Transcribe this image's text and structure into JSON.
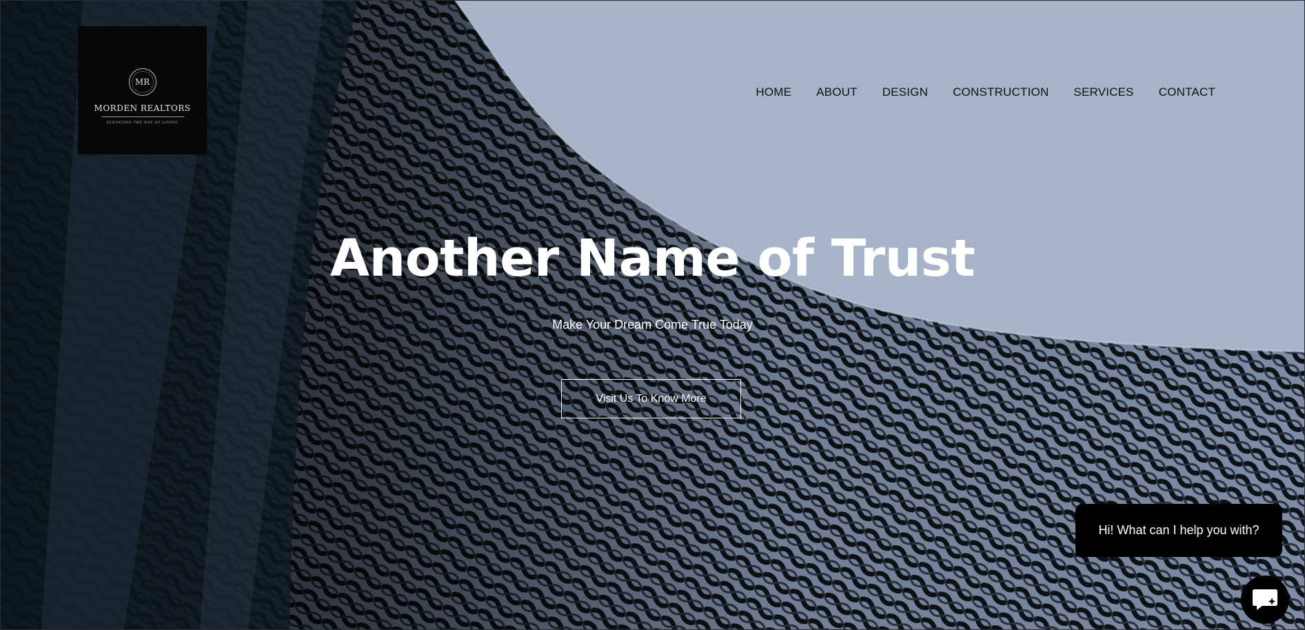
{
  "brand": {
    "monogram": "MR",
    "name": "MORDEN REALTORS",
    "tagline": "Elevating the Way of Living"
  },
  "nav": {
    "items": [
      {
        "label": "HOME"
      },
      {
        "label": "ABOUT"
      },
      {
        "label": "DESIGN"
      },
      {
        "label": "CONSTRUCTION"
      },
      {
        "label": "SERVICES"
      },
      {
        "label": "CONTACT"
      }
    ]
  },
  "hero": {
    "headline": "Another Name of Trust",
    "subheadline": "Make Your Dream Come True Today",
    "cta_label": "Visit Us To Know More"
  },
  "chat": {
    "greeting": "Hi! What can I help you with?",
    "launcher_icon": "chat-bubble-icon"
  },
  "colors": {
    "sky": "#a9b6cb",
    "dark": "#0b1216",
    "chat_bg": "#000000",
    "text_light": "#ffffff",
    "nav_text": "#111111"
  }
}
